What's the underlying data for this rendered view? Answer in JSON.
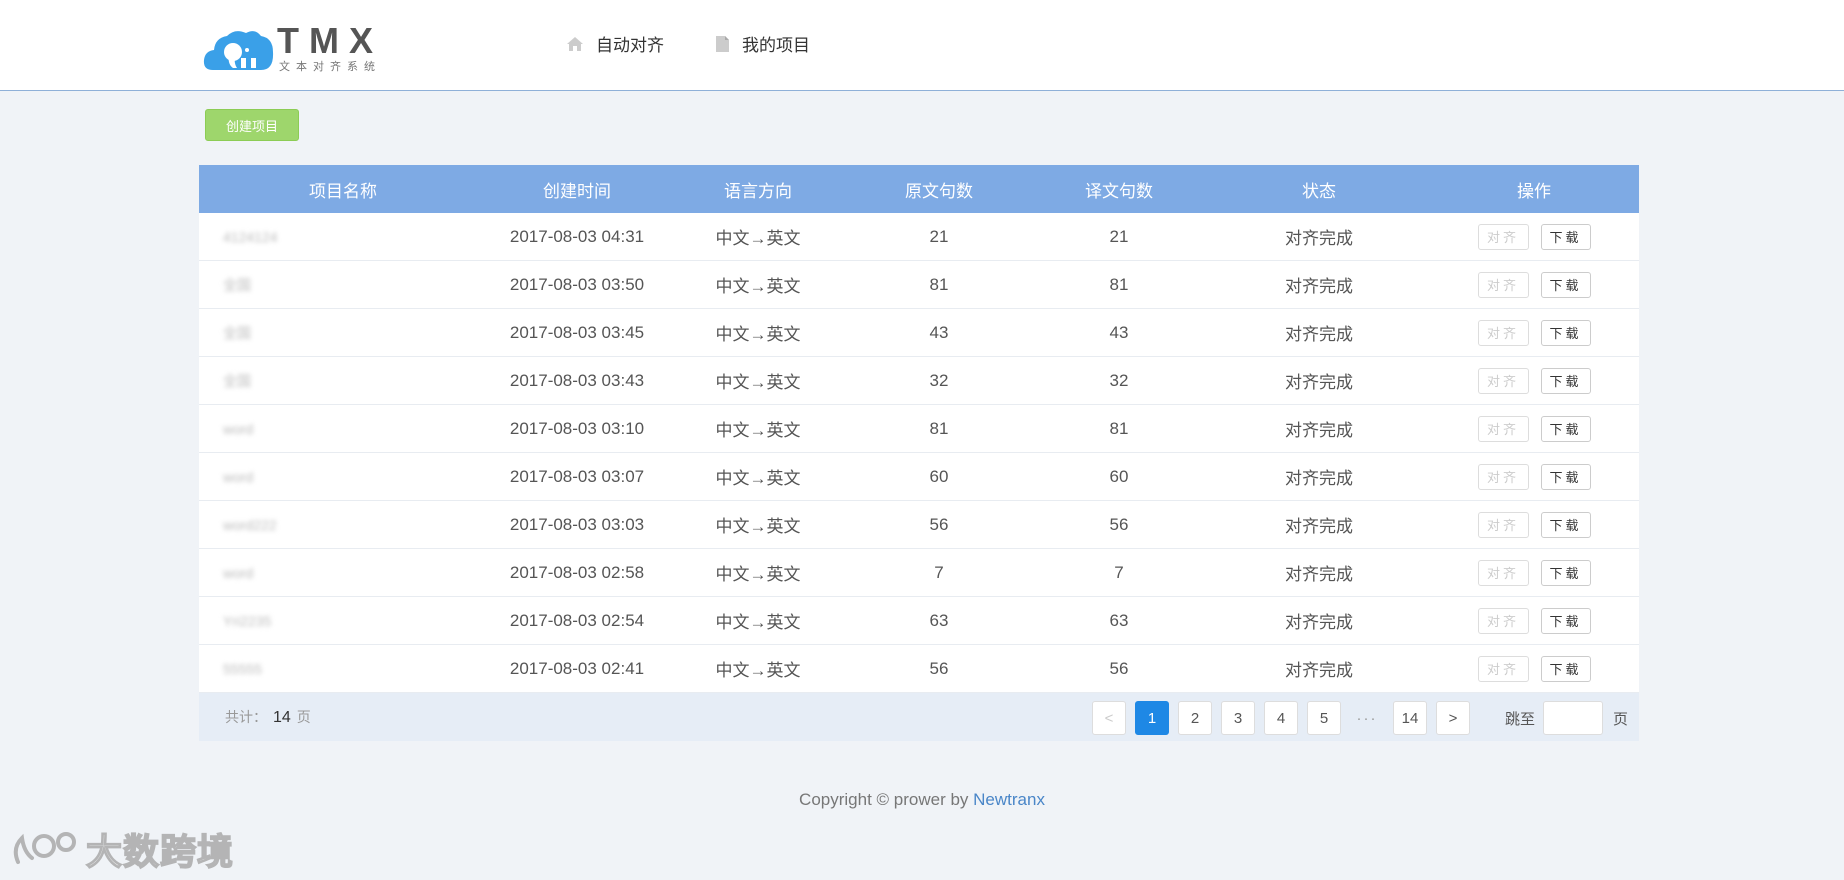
{
  "header": {
    "logo_text": "TMX",
    "logo_sub": "文本对齐系统",
    "nav": [
      {
        "label": "自动对齐",
        "icon": "home-icon"
      },
      {
        "label": "我的项目",
        "icon": "document-icon"
      }
    ]
  },
  "toolbar": {
    "create_label": "创建项目"
  },
  "table": {
    "headers": [
      "项目名称",
      "创建时间",
      "语言方向",
      "原文句数",
      "译文句数",
      "状态",
      "操作"
    ],
    "rows": [
      {
        "name": "4124124",
        "time": "2017-08-03 04:31",
        "direction": "中文→英文",
        "src": "21",
        "tgt": "21",
        "status": "对齐完成"
      },
      {
        "name": "全国",
        "time": "2017-08-03 03:50",
        "direction": "中文→英文",
        "src": "81",
        "tgt": "81",
        "status": "对齐完成"
      },
      {
        "name": "全国",
        "time": "2017-08-03 03:45",
        "direction": "中文→英文",
        "src": "43",
        "tgt": "43",
        "status": "对齐完成"
      },
      {
        "name": "全国",
        "time": "2017-08-03 03:43",
        "direction": "中文→英文",
        "src": "32",
        "tgt": "32",
        "status": "对齐完成"
      },
      {
        "name": "word",
        "time": "2017-08-03 03:10",
        "direction": "中文→英文",
        "src": "81",
        "tgt": "81",
        "status": "对齐完成"
      },
      {
        "name": "word",
        "time": "2017-08-03 03:07",
        "direction": "中文→英文",
        "src": "60",
        "tgt": "60",
        "status": "对齐完成"
      },
      {
        "name": "word222",
        "time": "2017-08-03 03:03",
        "direction": "中文→英文",
        "src": "56",
        "tgt": "56",
        "status": "对齐完成"
      },
      {
        "name": "word",
        "time": "2017-08-03 02:58",
        "direction": "中文→英文",
        "src": "7",
        "tgt": "7",
        "status": "对齐完成"
      },
      {
        "name": "Yri2235",
        "time": "2017-08-03 02:54",
        "direction": "中文→英文",
        "src": "63",
        "tgt": "63",
        "status": "对齐完成"
      },
      {
        "name": "55555",
        "time": "2017-08-03 02:41",
        "direction": "中文→英文",
        "src": "56",
        "tgt": "56",
        "status": "对齐完成"
      }
    ],
    "action_align": "对齐",
    "action_download": "下载"
  },
  "pagination": {
    "total_prefix": "共计：",
    "total_pages": "14",
    "total_suffix": "页",
    "prev": "<",
    "next": ">",
    "pages": [
      "1",
      "2",
      "3",
      "4",
      "5"
    ],
    "ellipsis": "···",
    "last": "14",
    "current": "1",
    "jump_label": "跳至",
    "jump_value": "",
    "jump_unit": "页"
  },
  "footer": {
    "copyright": "Copyright © prower by ",
    "link": "Newtranx"
  },
  "watermark": {
    "text": "大数跨境"
  },
  "colors": {
    "header_bg": "#7eaae4",
    "create_btn": "#9ed66c",
    "active_page": "#1e88e5",
    "link": "#4a86c8"
  }
}
